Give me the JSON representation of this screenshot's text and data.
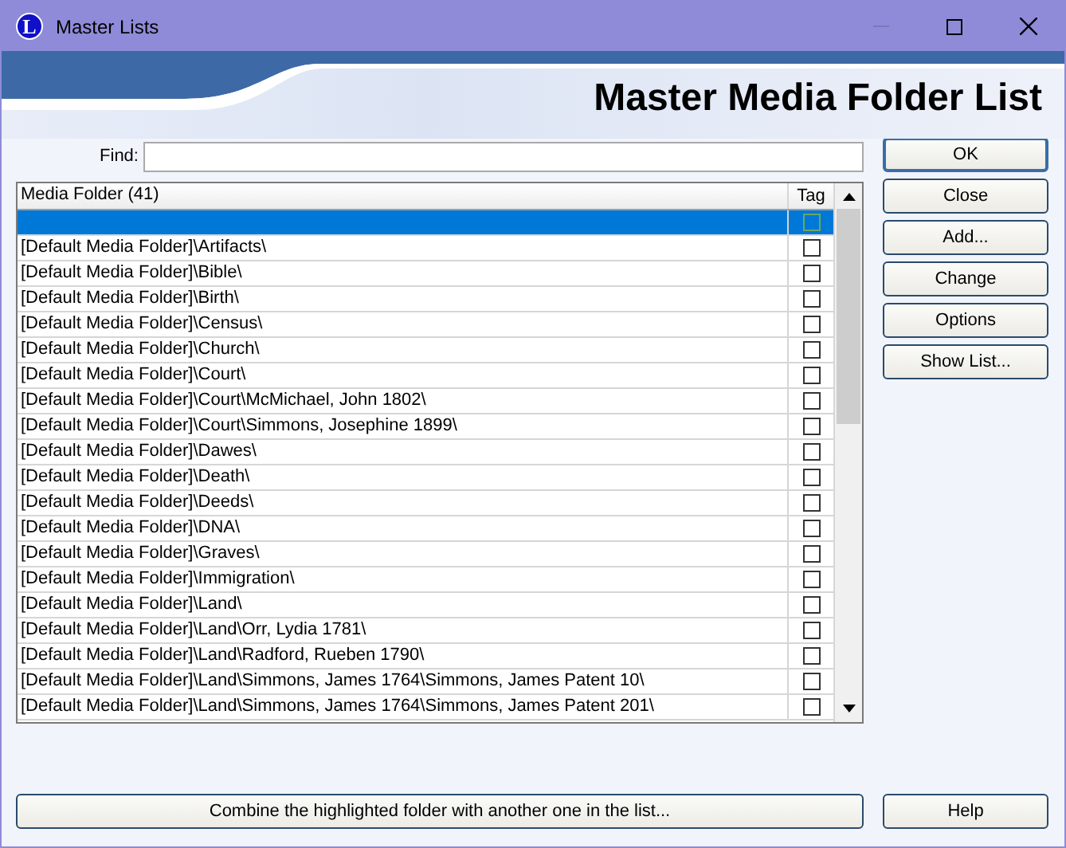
{
  "window": {
    "title": "Master Lists",
    "icon_letter": "L"
  },
  "heading": "Master Media Folder List",
  "find": {
    "label": "Find:"
  },
  "table": {
    "columns": [
      "Media Folder (41)",
      "Tag"
    ],
    "rows": [
      {
        "folder": "",
        "tag": false,
        "selected": true
      },
      {
        "folder": "[Default Media Folder]\\Artifacts\\",
        "tag": false,
        "selected": false
      },
      {
        "folder": "[Default Media Folder]\\Bible\\",
        "tag": false,
        "selected": false
      },
      {
        "folder": "[Default Media Folder]\\Birth\\",
        "tag": false,
        "selected": false
      },
      {
        "folder": "[Default Media Folder]\\Census\\",
        "tag": false,
        "selected": false
      },
      {
        "folder": "[Default Media Folder]\\Church\\",
        "tag": false,
        "selected": false
      },
      {
        "folder": "[Default Media Folder]\\Court\\",
        "tag": false,
        "selected": false
      },
      {
        "folder": "[Default Media Folder]\\Court\\McMichael, John 1802\\",
        "tag": false,
        "selected": false
      },
      {
        "folder": "[Default Media Folder]\\Court\\Simmons, Josephine 1899\\",
        "tag": false,
        "selected": false
      },
      {
        "folder": "[Default Media Folder]\\Dawes\\",
        "tag": false,
        "selected": false
      },
      {
        "folder": "[Default Media Folder]\\Death\\",
        "tag": false,
        "selected": false
      },
      {
        "folder": "[Default Media Folder]\\Deeds\\",
        "tag": false,
        "selected": false
      },
      {
        "folder": "[Default Media Folder]\\DNA\\",
        "tag": false,
        "selected": false
      },
      {
        "folder": "[Default Media Folder]\\Graves\\",
        "tag": false,
        "selected": false
      },
      {
        "folder": "[Default Media Folder]\\Immigration\\",
        "tag": false,
        "selected": false
      },
      {
        "folder": "[Default Media Folder]\\Land\\",
        "tag": false,
        "selected": false
      },
      {
        "folder": "[Default Media Folder]\\Land\\Orr, Lydia 1781\\",
        "tag": false,
        "selected": false
      },
      {
        "folder": "[Default Media Folder]\\Land\\Radford, Rueben 1790\\",
        "tag": false,
        "selected": false
      },
      {
        "folder": "[Default Media Folder]\\Land\\Simmons, James 1764\\Simmons, James Patent 10\\",
        "tag": false,
        "selected": false
      },
      {
        "folder": "[Default Media Folder]\\Land\\Simmons, James 1764\\Simmons, James Patent 201\\",
        "tag": false,
        "selected": false
      }
    ]
  },
  "side_buttons": [
    {
      "label": "OK",
      "default": true
    },
    {
      "label": "Close",
      "default": false
    },
    {
      "label": "Add...",
      "default": false
    },
    {
      "label": "Change",
      "default": false
    },
    {
      "label": "Options",
      "default": false
    },
    {
      "label": "Show List...",
      "default": false
    }
  ],
  "combine_button": "Combine the highlighted folder with another one in the list...",
  "help_button": "Help"
}
